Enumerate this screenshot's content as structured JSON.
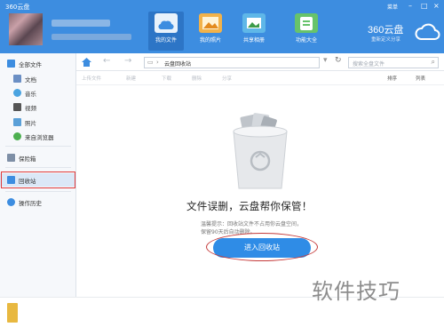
{
  "app": {
    "title": "360云盘"
  },
  "window": {
    "menu_label": "菜单"
  },
  "nav_tabs": [
    {
      "label": "我的文件",
      "icon": "folder-icon",
      "color": "#e9f2fb"
    },
    {
      "label": "我的照片",
      "icon": "photo-icon",
      "color": "#f2b24a"
    },
    {
      "label": "共享相册",
      "icon": "album-icon",
      "color": "#5fb7e8"
    },
    {
      "label": "功能大全",
      "icon": "apps-icon",
      "color": "#67c36b"
    }
  ],
  "brand": {
    "name": "360云盘",
    "tagline": "重新定义分享"
  },
  "sidebar": {
    "items": [
      {
        "label": "全部文件",
        "icon": "files-icon",
        "color": "#3d8de0"
      },
      {
        "label": "文档",
        "icon": "doc-icon",
        "color": "#6b8fc4"
      },
      {
        "label": "音乐",
        "icon": "music-icon",
        "color": "#4aa3e0"
      },
      {
        "label": "视频",
        "icon": "video-icon",
        "color": "#555555"
      },
      {
        "label": "照片",
        "icon": "image-icon",
        "color": "#5aa0d8"
      },
      {
        "label": "来自浏览器",
        "icon": "browser-icon",
        "color": "#4caf50"
      },
      {
        "label": "保险箱",
        "icon": "safe-icon",
        "color": "#7e8fa6"
      },
      {
        "label": "回收站",
        "icon": "recycle-icon",
        "color": "#3d8de0"
      },
      {
        "label": "操作历史",
        "icon": "history-icon",
        "color": "#3d8de0"
      }
    ]
  },
  "address": {
    "path": "云盘回收站",
    "search_placeholder": "搜索全盘文件"
  },
  "toolbar": {
    "upload": "上传文件",
    "new": "新建",
    "download": "下载",
    "delete": "删除",
    "more": "分享",
    "sort": "排序",
    "view": "列表"
  },
  "empty": {
    "title": "文件误删，云盘帮你保管！",
    "tip_line1": "温馨提示：回收站文件不占用你云盘空间，",
    "tip_line2": "保留90天后自动删除。",
    "button": "进入回收站"
  },
  "watermark": "软件技巧"
}
